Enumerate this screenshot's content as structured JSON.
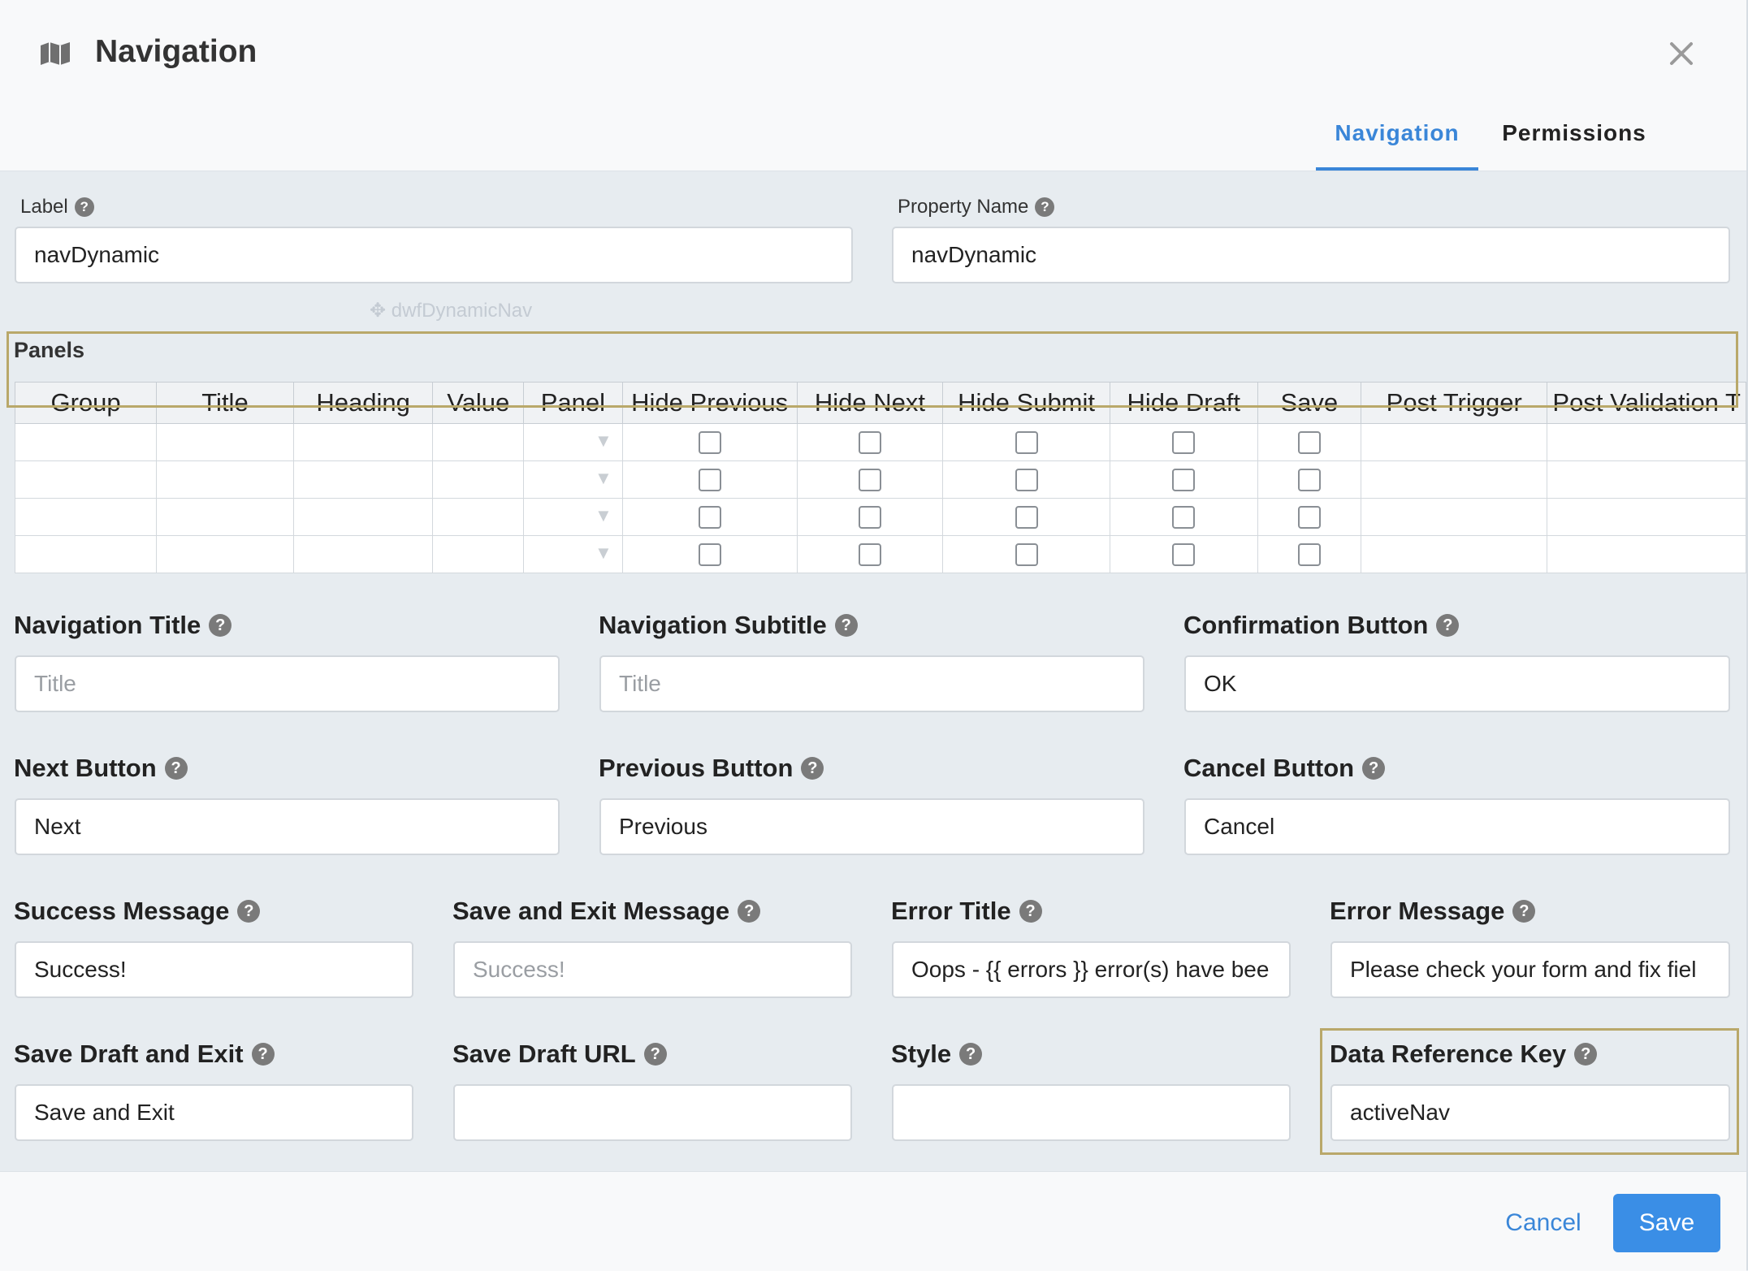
{
  "header": {
    "title": "Navigation",
    "title_icon": "map-icon",
    "close_icon": "close-icon"
  },
  "tabs": [
    {
      "label": "Navigation",
      "active": true
    },
    {
      "label": "Permissions",
      "active": false
    }
  ],
  "label_field": {
    "label": "Label",
    "value": "navDynamic"
  },
  "property_name_field": {
    "label": "Property Name",
    "value": "navDynamic"
  },
  "panels": {
    "label": "Panels",
    "columns": [
      "Group",
      "Title",
      "Heading",
      "Value",
      "Panel",
      "Hide Previous",
      "Hide Next",
      "Hide Submit",
      "Hide Draft",
      "Save",
      "Post Trigger",
      "Post Validation T"
    ],
    "row_count": 4
  },
  "fields": {
    "navigation_title": {
      "label": "Navigation Title",
      "placeholder": "Title",
      "value": ""
    },
    "navigation_subtitle": {
      "label": "Navigation Subtitle",
      "placeholder": "Title",
      "value": ""
    },
    "confirmation_button": {
      "label": "Confirmation Button",
      "value": "OK"
    },
    "next_button": {
      "label": "Next Button",
      "value": "Next"
    },
    "previous_button": {
      "label": "Previous Button",
      "value": "Previous"
    },
    "cancel_button": {
      "label": "Cancel Button",
      "value": "Cancel"
    },
    "success_message": {
      "label": "Success Message",
      "value": "Success!"
    },
    "save_exit_message": {
      "label": "Save and Exit Message",
      "placeholder": "Success!",
      "value": ""
    },
    "error_title": {
      "label": "Error Title",
      "value": "Oops - {{ errors }} error(s) have bee"
    },
    "error_message": {
      "label": "Error Message",
      "value": "Please check your form and fix fiel"
    },
    "save_draft_exit": {
      "label": "Save Draft and Exit",
      "value": "Save and Exit"
    },
    "save_draft_url": {
      "label": "Save Draft URL",
      "value": ""
    },
    "style": {
      "label": "Style",
      "value": ""
    },
    "data_reference_key": {
      "label": "Data Reference Key",
      "value": "activeNav"
    }
  },
  "footer": {
    "cancel_label": "Cancel",
    "save_label": "Save"
  },
  "colors": {
    "accent": "#3a86d8",
    "highlight": "#b9a86a",
    "save_bg": "#3a8ee6"
  }
}
